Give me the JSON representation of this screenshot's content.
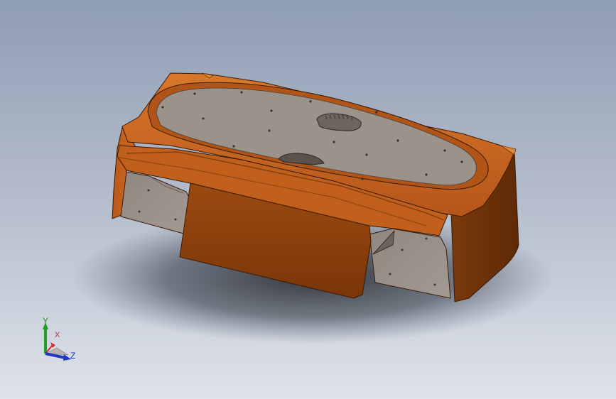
{
  "app": {
    "type": "CAD model viewport"
  },
  "colors": {
    "background_top": "#8f9db3",
    "background_bottom": "#dfe3ea",
    "body": "#c8651a",
    "body_dark": "#8a3e0c",
    "panel": "#9a8f85",
    "edge": "#3a1a05"
  },
  "triad": {
    "y_label": "Y",
    "x_label": "X",
    "z_label": "Z",
    "y_color": "#22a022",
    "x_color": "#d03030",
    "z_color": "#2038c0"
  }
}
